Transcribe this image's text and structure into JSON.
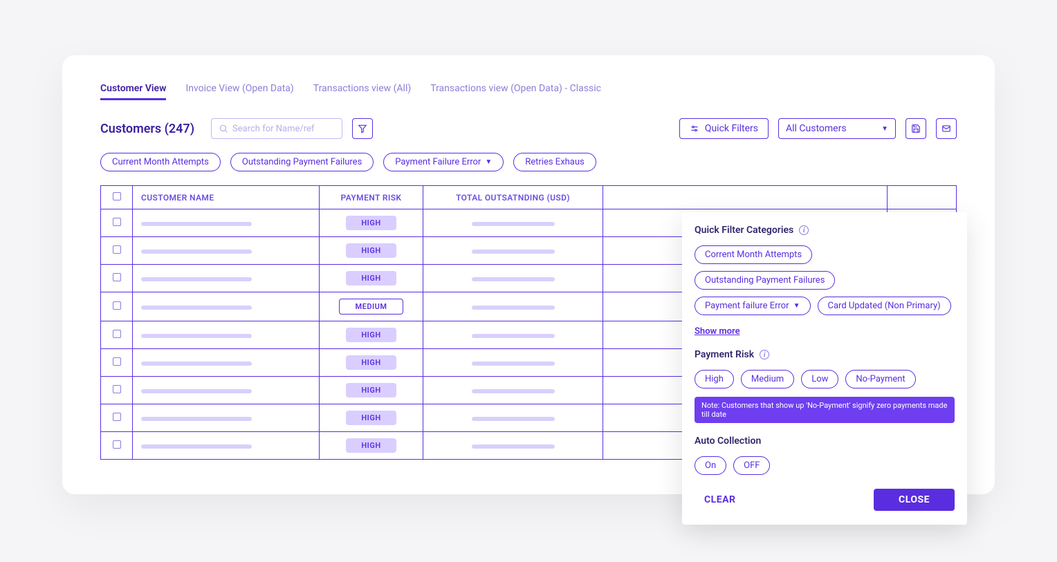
{
  "tabs": {
    "active": "Customer View",
    "items": [
      "Customer View",
      "Invoice View (Open Data)",
      "Transactions view (All)",
      "Transactions view (Open Data) - Classic"
    ]
  },
  "title": "Customers (247)",
  "search": {
    "placeholder": "Search for Name/ref"
  },
  "quick_filters_label": "Quick Filters",
  "segment_select": {
    "value": "All Customers"
  },
  "filter_chips": [
    "Current Month Attempts",
    "Outstanding Payment Failures",
    "Payment Failure Error",
    "Retries Exhaus"
  ],
  "filter_chip_has_dropdown": [
    false,
    false,
    true,
    false
  ],
  "table": {
    "headers": [
      "CUSTOMER NAME",
      "PAYMENT RISK",
      "TOTAL OUTSATNDING (USD)"
    ],
    "rows": [
      {
        "risk": "HIGH",
        "risk_class": "high"
      },
      {
        "risk": "HIGH",
        "risk_class": "high"
      },
      {
        "risk": "HIGH",
        "risk_class": "high"
      },
      {
        "risk": "MEDIUM",
        "risk_class": "med"
      },
      {
        "risk": "HIGH",
        "risk_class": "high"
      },
      {
        "risk": "HIGH",
        "risk_class": "high"
      },
      {
        "risk": "HIGH",
        "risk_class": "high"
      },
      {
        "risk": "HIGH",
        "risk_class": "high"
      },
      {
        "risk": "HIGH",
        "risk_class": "high"
      }
    ]
  },
  "popup": {
    "categories_label": "Quick Filter Categories",
    "category_chips": [
      "Corrent Month Attempts",
      "Outstanding Payment Failures",
      "Payment failure Error",
      "Card Updated (Non Primary)"
    ],
    "category_chip_has_dropdown": [
      false,
      false,
      true,
      false
    ],
    "show_more": "Show more",
    "risk_label": "Payment Risk",
    "risk_options": [
      "High",
      "Medium",
      "Low",
      "No-Payment"
    ],
    "note": "Note: Customers that show up 'No-Payment' signify zero payments made till date",
    "auto_label": "Auto Collection",
    "auto_options": [
      "On",
      "OFF"
    ],
    "clear": "CLEAR",
    "close": "CLOSE"
  }
}
